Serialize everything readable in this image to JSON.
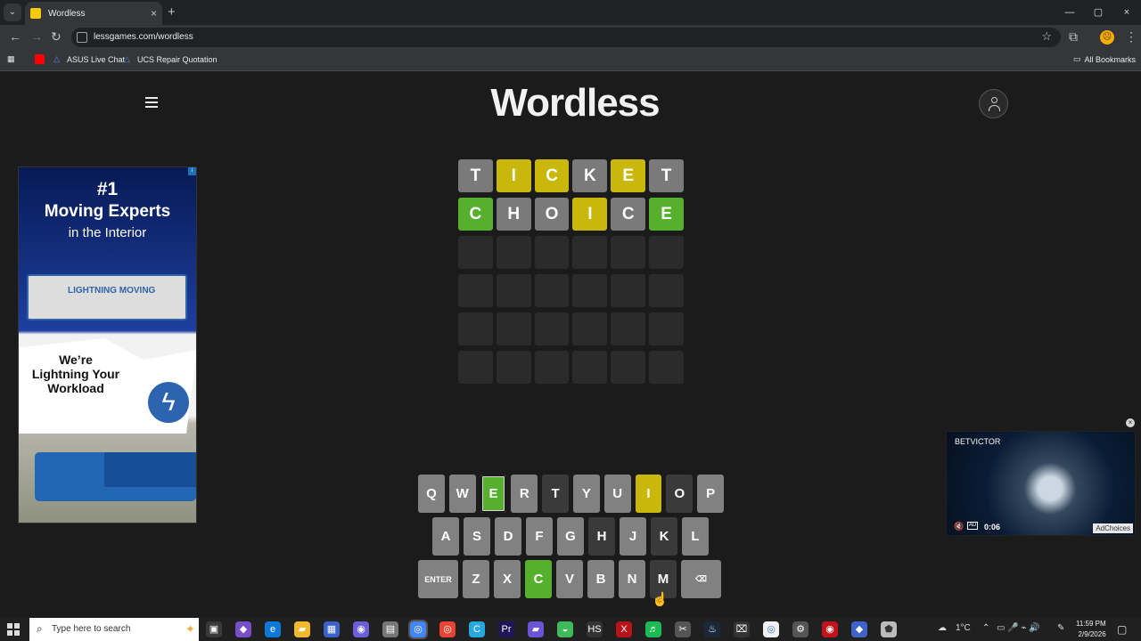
{
  "browser": {
    "tab_title": "Wordless",
    "url": "lessgames.com/wordless",
    "bookmarks": [
      "ASUS Live Chat",
      "UCS Repair Quotation"
    ],
    "all_bookmarks": "All Bookmarks"
  },
  "page": {
    "logo": "Wordless",
    "board": [
      [
        {
          "letter": "T",
          "state": "gray"
        },
        {
          "letter": "I",
          "state": "yellow"
        },
        {
          "letter": "C",
          "state": "yellow"
        },
        {
          "letter": "K",
          "state": "gray"
        },
        {
          "letter": "E",
          "state": "yellow"
        },
        {
          "letter": "T",
          "state": "gray"
        }
      ],
      [
        {
          "letter": "C",
          "state": "green"
        },
        {
          "letter": "H",
          "state": "gray"
        },
        {
          "letter": "O",
          "state": "gray"
        },
        {
          "letter": "I",
          "state": "yellow"
        },
        {
          "letter": "C",
          "state": "gray"
        },
        {
          "letter": "E",
          "state": "green"
        }
      ],
      [
        {
          "letter": "",
          "state": "empty"
        },
        {
          "letter": "",
          "state": "empty"
        },
        {
          "letter": "",
          "state": "empty"
        },
        {
          "letter": "",
          "state": "empty"
        },
        {
          "letter": "",
          "state": "empty"
        },
        {
          "letter": "",
          "state": "empty"
        }
      ],
      [
        {
          "letter": "",
          "state": "empty"
        },
        {
          "letter": "",
          "state": "empty"
        },
        {
          "letter": "",
          "state": "empty"
        },
        {
          "letter": "",
          "state": "empty"
        },
        {
          "letter": "",
          "state": "empty"
        },
        {
          "letter": "",
          "state": "empty"
        }
      ],
      [
        {
          "letter": "",
          "state": "empty"
        },
        {
          "letter": "",
          "state": "empty"
        },
        {
          "letter": "",
          "state": "empty"
        },
        {
          "letter": "",
          "state": "empty"
        },
        {
          "letter": "",
          "state": "empty"
        },
        {
          "letter": "",
          "state": "empty"
        }
      ],
      [
        {
          "letter": "",
          "state": "empty"
        },
        {
          "letter": "",
          "state": "empty"
        },
        {
          "letter": "",
          "state": "empty"
        },
        {
          "letter": "",
          "state": "empty"
        },
        {
          "letter": "",
          "state": "empty"
        },
        {
          "letter": "",
          "state": "empty"
        }
      ]
    ],
    "keyboard": [
      [
        {
          "key": "Q",
          "state": "gray"
        },
        {
          "key": "W",
          "state": "gray"
        },
        {
          "key": "E",
          "state": "green",
          "selected": true
        },
        {
          "key": "R",
          "state": "gray"
        },
        {
          "key": "T",
          "state": "dark"
        },
        {
          "key": "Y",
          "state": "gray"
        },
        {
          "key": "U",
          "state": "gray"
        },
        {
          "key": "I",
          "state": "yellow"
        },
        {
          "key": "O",
          "state": "dark"
        },
        {
          "key": "P",
          "state": "gray"
        }
      ],
      [
        {
          "key": "A",
          "state": "gray"
        },
        {
          "key": "S",
          "state": "gray"
        },
        {
          "key": "D",
          "state": "gray"
        },
        {
          "key": "F",
          "state": "gray"
        },
        {
          "key": "G",
          "state": "gray"
        },
        {
          "key": "H",
          "state": "dark"
        },
        {
          "key": "J",
          "state": "gray"
        },
        {
          "key": "K",
          "state": "dark"
        },
        {
          "key": "L",
          "state": "gray"
        }
      ],
      [
        {
          "key": "ENTER",
          "state": "gray",
          "wide": true
        },
        {
          "key": "Z",
          "state": "gray"
        },
        {
          "key": "X",
          "state": "gray"
        },
        {
          "key": "C",
          "state": "green"
        },
        {
          "key": "V",
          "state": "gray"
        },
        {
          "key": "B",
          "state": "gray"
        },
        {
          "key": "N",
          "state": "gray"
        },
        {
          "key": "M",
          "state": "dark"
        },
        {
          "key": "⌫",
          "state": "gray",
          "wide": true
        }
      ]
    ]
  },
  "ads": {
    "left_rank": "#1",
    "left_headline": "Moving Experts",
    "left_subline": "in the Interior",
    "left_company": "LIGHTNING MOVING",
    "left_slogan": "We’re Lightning Your Workload",
    "video_brand": "BETVICTOR",
    "video_time": "0:06",
    "adchoices": "AdChoices"
  },
  "taskbar": {
    "search_placeholder": "Type here to search",
    "weather": "1°C",
    "time": "11:59 PM",
    "date": "2/9/2026"
  }
}
